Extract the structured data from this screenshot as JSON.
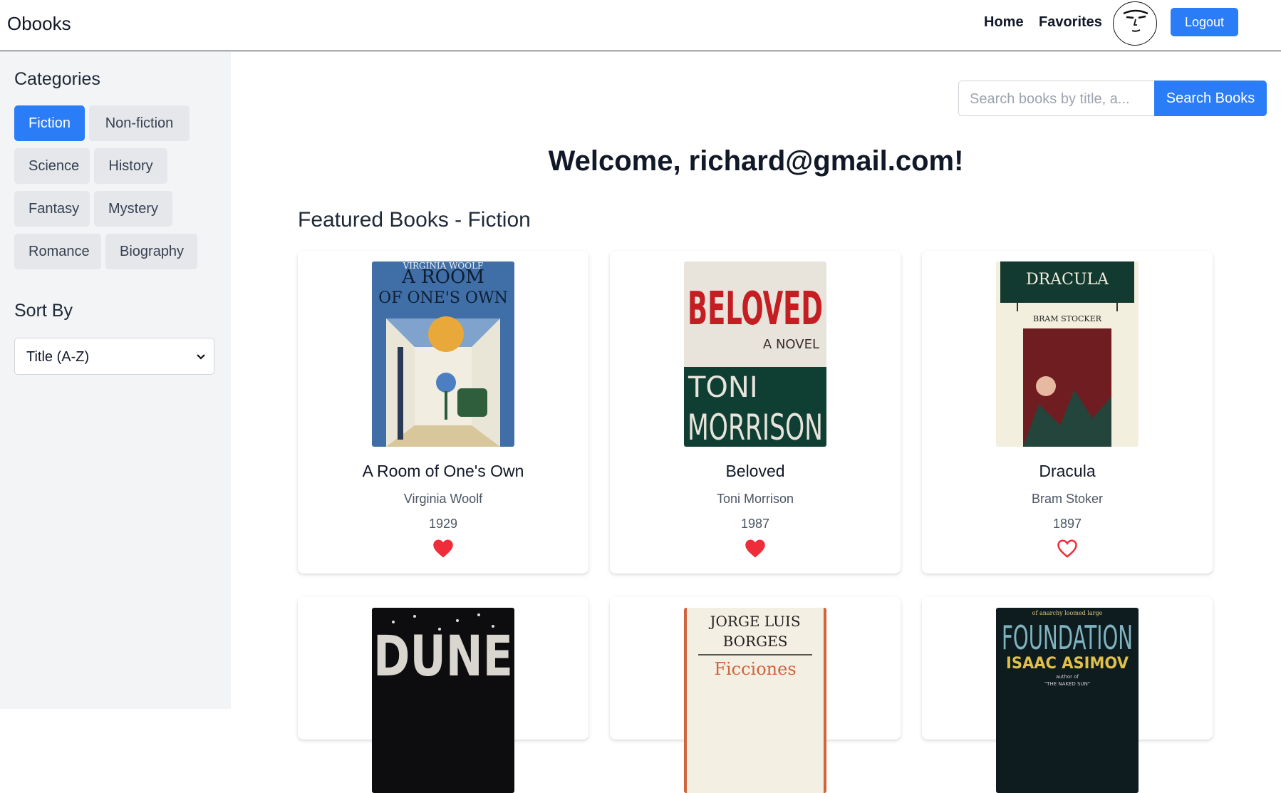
{
  "header": {
    "brand": "Obooks",
    "nav": {
      "home": "Home",
      "favorites": "Favorites"
    },
    "logout_label": "Logout",
    "avatar_icon": "avatar-face-icon"
  },
  "sidebar": {
    "categories_title": "Categories",
    "categories": [
      {
        "label": "Fiction",
        "active": true
      },
      {
        "label": "Non-fiction",
        "active": false
      },
      {
        "label": "Science",
        "active": false
      },
      {
        "label": "History",
        "active": false
      },
      {
        "label": "Fantasy",
        "active": false
      },
      {
        "label": "Mystery",
        "active": false
      },
      {
        "label": "Romance",
        "active": false
      },
      {
        "label": "Biography",
        "active": false
      }
    ],
    "sort_title": "Sort By",
    "sort_value": "Title (A-Z)"
  },
  "search": {
    "placeholder": "Search books by title, a...",
    "button_label": "Search Books"
  },
  "main": {
    "welcome": "Welcome, richard@gmail.com!",
    "section_title": "Featured Books - Fiction",
    "books": [
      {
        "title": "A Room of One's Own",
        "author": "Virginia Woolf",
        "year": "1929",
        "favorited": true,
        "cover_text": [
          "VIRGINIA WOOLF",
          "A ROOM",
          "OF ONE'S OWN"
        ]
      },
      {
        "title": "Beloved",
        "author": "Toni Morrison",
        "year": "1987",
        "favorited": true,
        "cover_text": [
          "BELOVED",
          "A NOVEL",
          "TONI",
          "MORRISON"
        ]
      },
      {
        "title": "Dracula",
        "author": "Bram Stoker",
        "year": "1897",
        "favorited": false,
        "cover_text": [
          "DRACULA",
          "BRAM STOCKER"
        ]
      },
      {
        "cover_text": [
          "DUNE"
        ]
      },
      {
        "cover_text": [
          "JORGE LUIS",
          "BORGES",
          "Ficciones"
        ]
      },
      {
        "cover_text": [
          "of anarchy loomed large",
          "FOUNDATION",
          "ISAAC ASIMOV",
          "author of",
          "\"THE NAKED SUN\""
        ]
      }
    ]
  },
  "colors": {
    "accent": "#2b7df7",
    "heart": "#ef2d3a",
    "sidebar_bg": "#f3f4f6",
    "category_bg": "#e5e7eb"
  }
}
